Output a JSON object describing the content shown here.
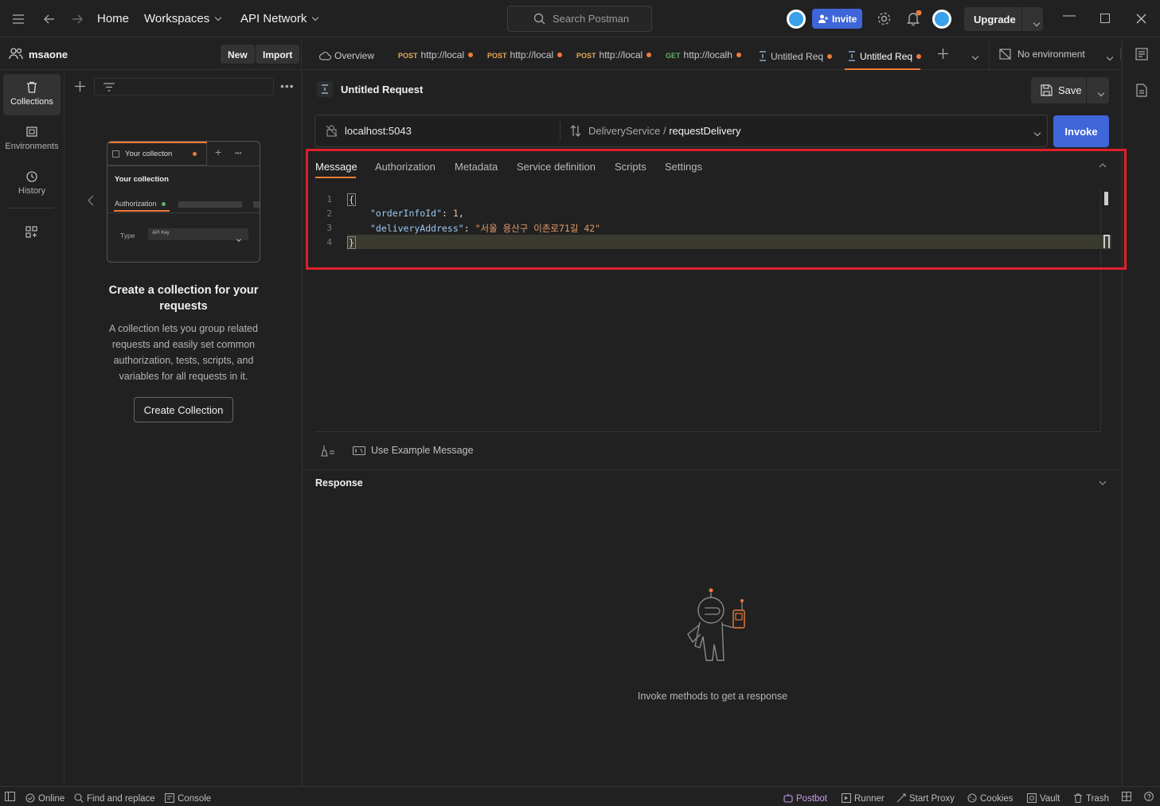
{
  "header": {
    "nav": {
      "home": "Home",
      "workspaces": "Workspaces",
      "api_network": "API Network"
    },
    "search_placeholder": "Search Postman",
    "invite_label": "Invite",
    "upgrade_label": "Upgrade"
  },
  "workspace": {
    "name": "msaone",
    "new_label": "New",
    "import_label": "Import"
  },
  "rail": {
    "collections": "Collections",
    "environments": "Environments",
    "history": "History"
  },
  "preview_card": {
    "tab_label": "Your collecton",
    "collection_label": "Your collection",
    "auth_label": "Authorization",
    "type_label": "Type",
    "type_value": "API Key"
  },
  "empty_state": {
    "title": "Create a collection for your requests",
    "body": "A collection lets you group related requests and easily set common authorization, tests, scripts, and variables for all requests in it.",
    "button": "Create Collection"
  },
  "tabs": [
    {
      "method": "",
      "label": "Overview"
    },
    {
      "method": "POST",
      "label": "http://local"
    },
    {
      "method": "POST",
      "label": "http://local"
    },
    {
      "method": "POST",
      "label": "http://local"
    },
    {
      "method": "GET",
      "label": "http://localh"
    },
    {
      "method": "",
      "label": "Untitled Req"
    },
    {
      "method": "",
      "label": "Untitled Req"
    }
  ],
  "environment": "No environment",
  "request": {
    "title": "Untitled Request",
    "save_label": "Save",
    "url": "localhost:5043",
    "service": "DeliveryService",
    "method_sep": "/",
    "method": "requestDelivery",
    "invoke_label": "Invoke"
  },
  "subtabs": [
    "Message",
    "Authorization",
    "Metadata",
    "Service definition",
    "Scripts",
    "Settings"
  ],
  "editor": {
    "line_numbers": [
      "1",
      "2",
      "3",
      "4"
    ],
    "open_brace": "{",
    "close_brace": "}",
    "key1": "\"orderInfoId\"",
    "val1": "1",
    "key2": "\"deliveryAddress\"",
    "val2": "\"서울 용산구 이촌로71길 42\""
  },
  "use_example": "Use Example Message",
  "response": {
    "title": "Response",
    "empty_text": "Invoke methods to get a response"
  },
  "statusbar": {
    "online": "Online",
    "find_replace": "Find and replace",
    "console": "Console",
    "postbot": "Postbot",
    "runner": "Runner",
    "start_proxy": "Start Proxy",
    "cookies": "Cookies",
    "vault": "Vault",
    "trash": "Trash"
  },
  "colors": {
    "accent": "#ee7b3a",
    "primary": "#3f66d9",
    "highlight": "#e0202a",
    "postbot": "#c99cf0"
  }
}
